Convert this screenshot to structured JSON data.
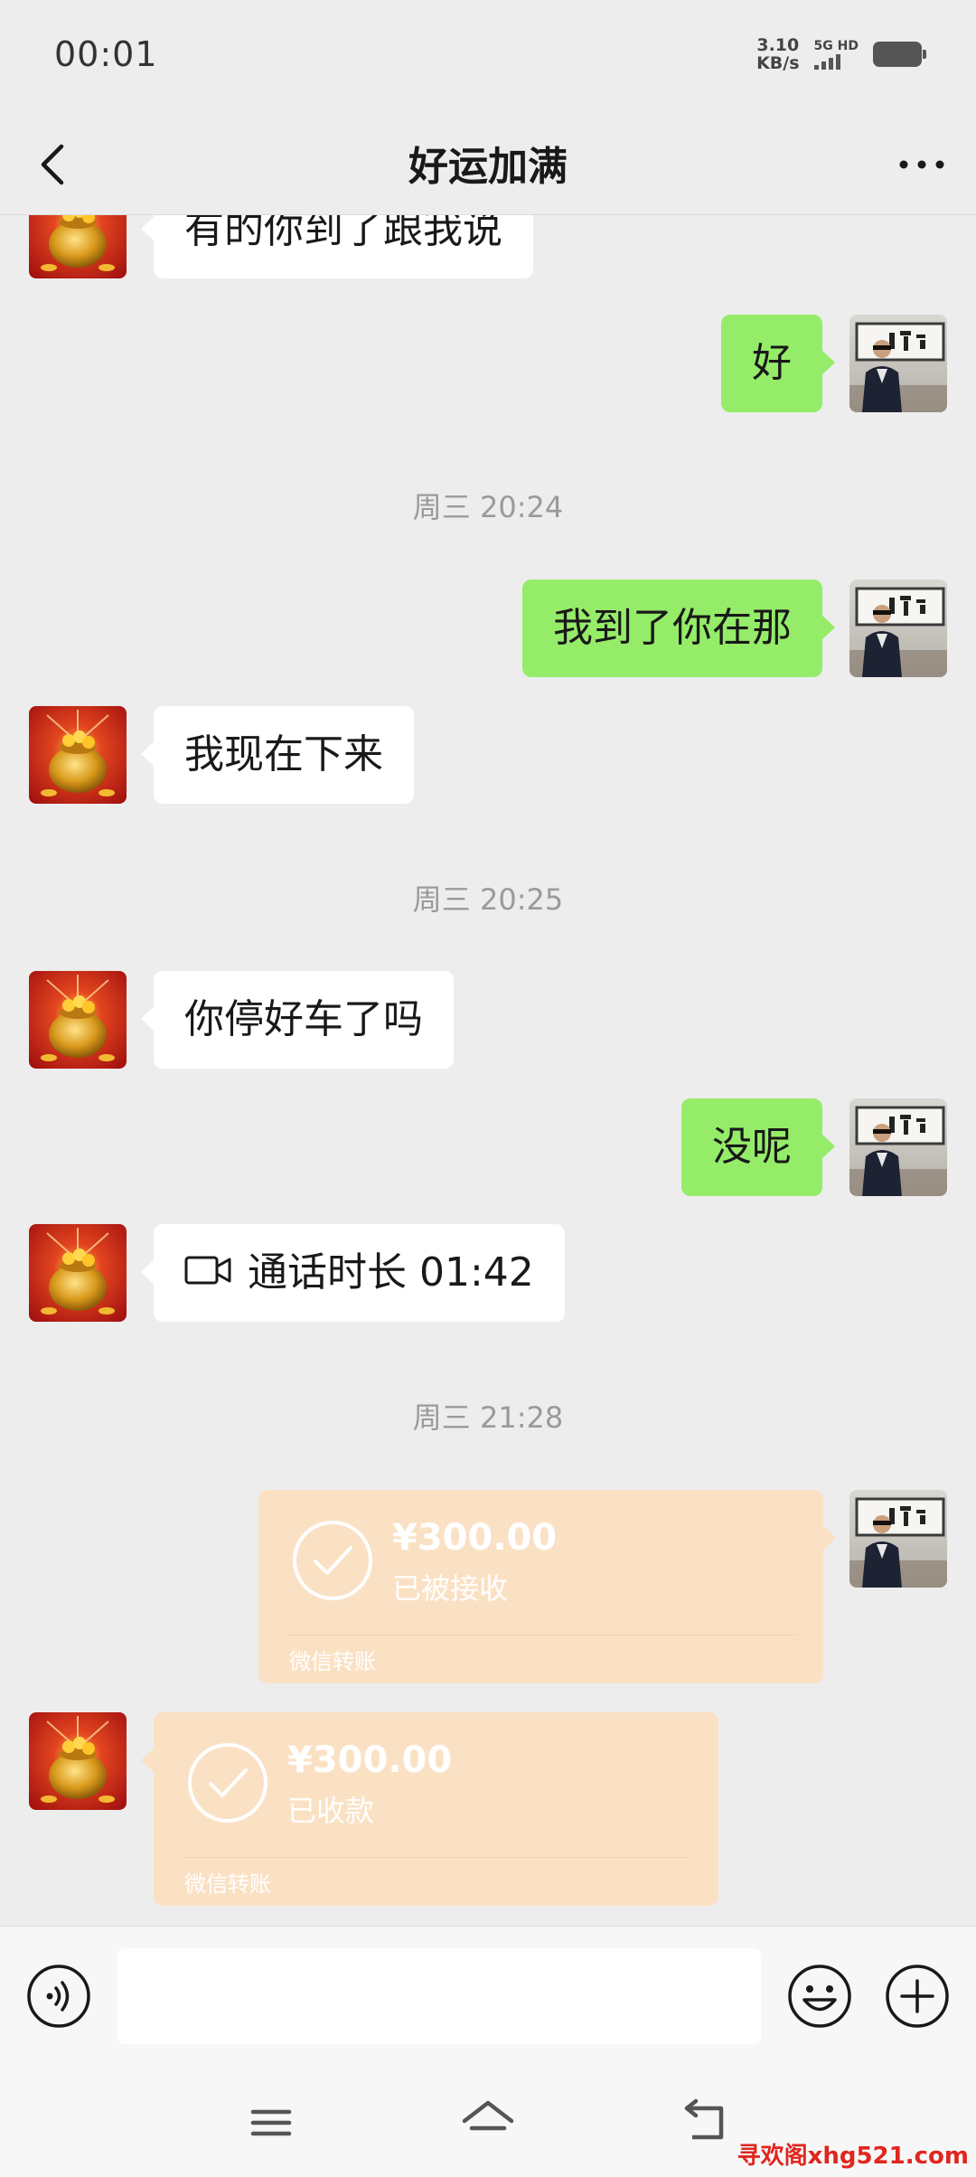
{
  "status_bar": {
    "time": "00:01",
    "net_speed_value": "3.10",
    "net_speed_unit": "KB/s",
    "signal_label": "5G HD"
  },
  "header": {
    "title": "好运加满",
    "back_icon": "chevron-left-icon",
    "more_icon": "more-dots-icon"
  },
  "messages": [
    {
      "id": "m1",
      "side": "left",
      "type": "text",
      "text": "有的你到了跟我说"
    },
    {
      "id": "m2",
      "side": "right",
      "type": "text",
      "text": "好"
    },
    {
      "id": "t1",
      "type": "timestamp",
      "text": "周三 20:24"
    },
    {
      "id": "m3",
      "side": "right",
      "type": "text",
      "text": "我到了你在那"
    },
    {
      "id": "m4",
      "side": "left",
      "type": "text",
      "text": "我现在下来"
    },
    {
      "id": "t2",
      "type": "timestamp",
      "text": "周三 20:25"
    },
    {
      "id": "m5",
      "side": "left",
      "type": "text",
      "text": "你停好车了吗"
    },
    {
      "id": "m6",
      "side": "right",
      "type": "text",
      "text": "没呢"
    },
    {
      "id": "m7",
      "side": "left",
      "type": "call",
      "text": "通话时长 01:42",
      "icon": "video-camera-icon"
    },
    {
      "id": "t3",
      "type": "timestamp",
      "text": "周三 21:28"
    },
    {
      "id": "m8",
      "side": "right",
      "type": "transfer",
      "amount": "¥300.00",
      "status": "已被接收",
      "label": "微信转账"
    },
    {
      "id": "m9",
      "side": "left",
      "type": "transfer",
      "amount": "¥300.00",
      "status": "已收款",
      "label": "微信转账"
    }
  ],
  "input_bar": {
    "voice_icon": "voice-icon",
    "emoji_icon": "emoji-icon",
    "plus_icon": "plus-circle-icon",
    "placeholder": ""
  },
  "nav_bar": {
    "menu_icon": "menu-icon",
    "home_icon": "home-icon",
    "back_icon": "back-icon",
    "watermark": "寻欢阁xhg521.com"
  },
  "colors": {
    "background": "#ededed",
    "outgoing_bubble": "#95ec69",
    "incoming_bubble": "#ffffff",
    "transfer_bubble": "#fbe1c4",
    "watermark": "#e0261e"
  }
}
